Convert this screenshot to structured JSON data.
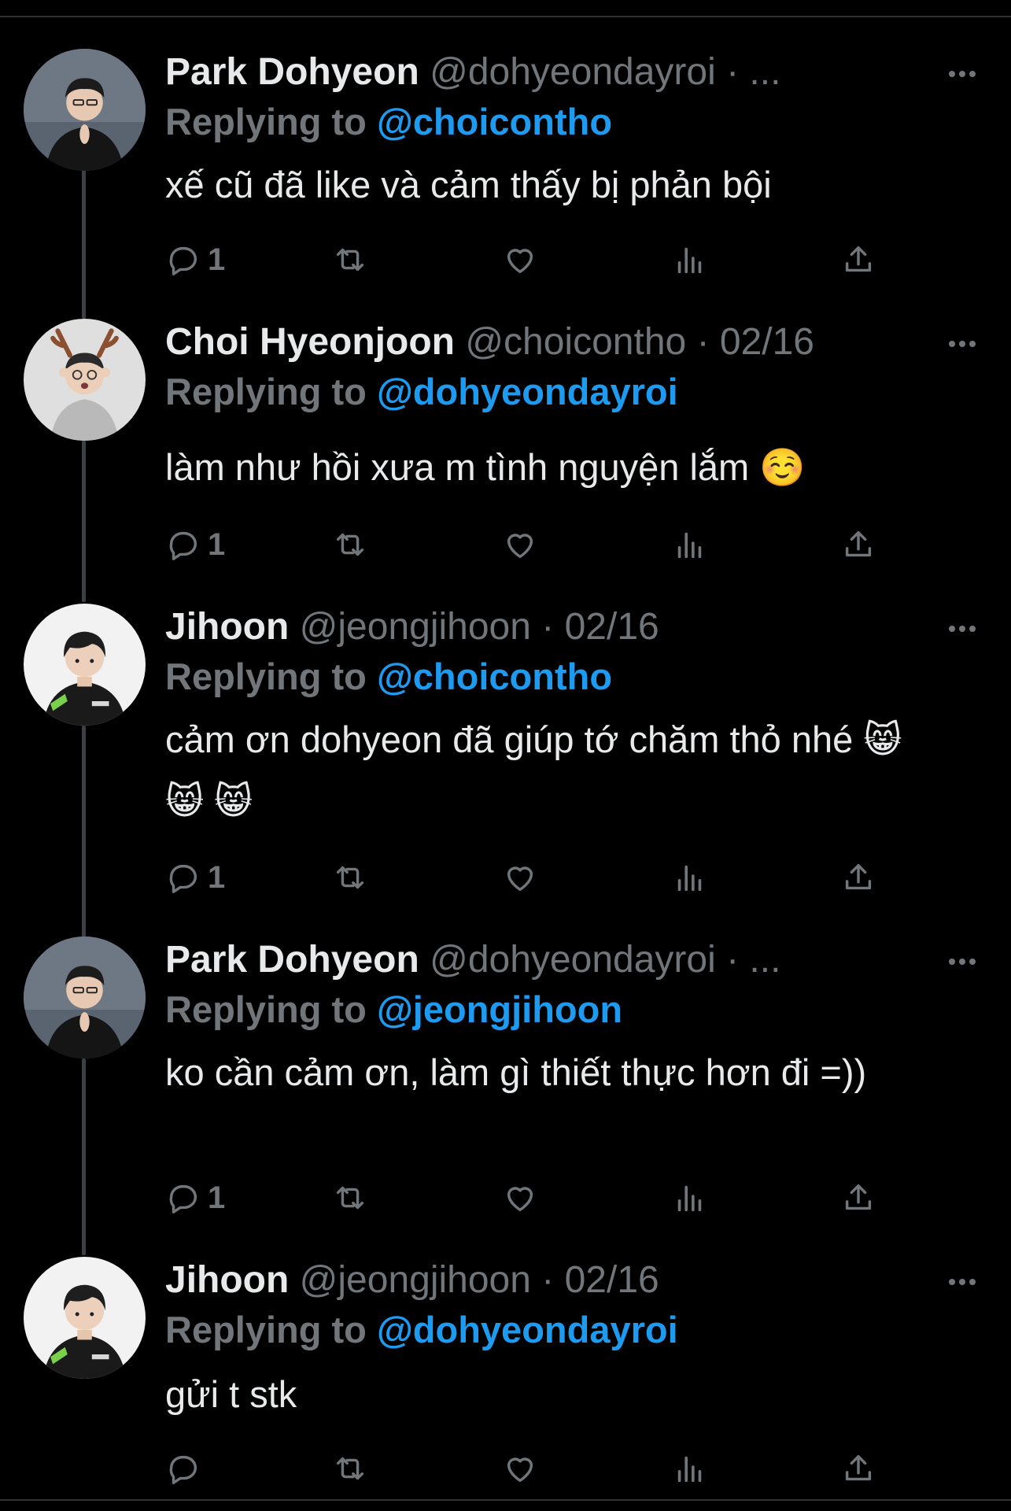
{
  "tweets": [
    {
      "name": "Park Dohyeon",
      "handle": "@dohyeondayroi",
      "time": "· ...",
      "reply_prefix": "Replying to",
      "reply_to": "@choicontho",
      "text": "xế cũ đã like và cảm thấy bị phản bội",
      "reply_count": "1",
      "avatar": "person-dark-jacket-avatar"
    },
    {
      "name": "Choi Hyeonjoon",
      "handle": "@choicontho",
      "time": "· 02/16",
      "reply_prefix": "Replying to",
      "reply_to": "@dohyeondayroi",
      "text": "làm như hồi xưa m tình nguyện lắm ☺️",
      "reply_count": "1",
      "avatar": "person-reindeer-antlers-avatar"
    },
    {
      "name": "Jihoon",
      "handle": "@jeongjihoon",
      "time": "· 02/16",
      "reply_prefix": "Replying to",
      "reply_to": "@choicontho",
      "text": "cảm ơn dohyeon đã giúp tớ chăm thỏ nhé 😸 😸 😸",
      "reply_count": "1",
      "avatar": "person-team-jersey-avatar"
    },
    {
      "name": "Park Dohyeon",
      "handle": "@dohyeondayroi",
      "time": "· ...",
      "reply_prefix": "Replying to",
      "reply_to": "@jeongjihoon",
      "text": "ko cần cảm ơn, làm gì thiết thực hơn đi =))",
      "reply_count": "1",
      "avatar": "person-dark-jacket-avatar"
    },
    {
      "name": "Jihoon",
      "handle": "@jeongjihoon",
      "time": "· 02/16",
      "reply_prefix": "Replying to",
      "reply_to": "@dohyeondayroi",
      "text": "gửi t stk",
      "reply_count": "",
      "avatar": "person-team-jersey-avatar"
    }
  ],
  "icons": {
    "reply": "reply-bubble-icon",
    "retweet": "retweet-icon",
    "like": "heart-icon",
    "views": "analytics-bars-icon",
    "share": "share-upload-icon",
    "more": "more-dots-icon"
  },
  "colors": {
    "background": "#000000",
    "primary_text": "#e7e9ea",
    "secondary_text": "#71767b",
    "link": "#1d9bf0",
    "thread_line": "#3c4045"
  }
}
